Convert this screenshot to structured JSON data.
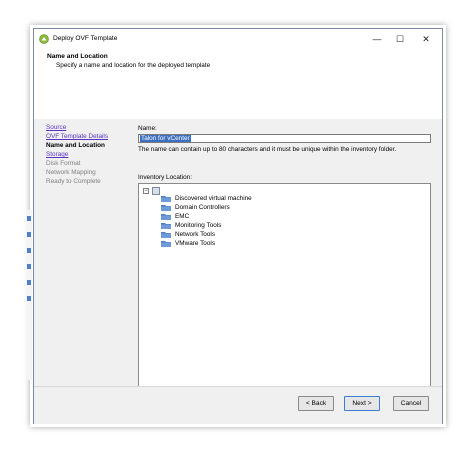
{
  "window": {
    "title": "Deploy OVF Template"
  },
  "header": {
    "title": "Name and Location",
    "subtitle": "Specify a name and location for the deployed template"
  },
  "steps": [
    {
      "label": "Source",
      "state": "link"
    },
    {
      "label": "OVF Template Details",
      "state": "link"
    },
    {
      "label": "Name and Location",
      "state": "current"
    },
    {
      "label": "Storage",
      "state": "link"
    },
    {
      "label": "Disk Format",
      "state": "disabled"
    },
    {
      "label": "Network Mapping",
      "state": "disabled"
    },
    {
      "label": "Ready to Complete",
      "state": "disabled"
    }
  ],
  "form": {
    "name_label": "Name:",
    "name_value": "Talon for vCenter",
    "hint": "The name can contain up to 80 characters and it must be unique within the inventory folder.",
    "inventory_label": "Inventory Location:",
    "tree_expander": "−",
    "tree_items": [
      "Discovered virtual machine",
      "Domain Controllers",
      "EMC",
      "Monitoring Tools",
      "Network Tools",
      "VMware Tools"
    ]
  },
  "buttons": {
    "back": "< Back",
    "next": "Next >",
    "cancel": "Cancel"
  },
  "controls": {
    "minimize": "—",
    "maximize": "☐",
    "close": "✕"
  },
  "colors": {
    "link": "#5a33c0",
    "selection": "#3c6fbf",
    "folder": "#4f7fc4",
    "accent": "#3c7fd1"
  }
}
